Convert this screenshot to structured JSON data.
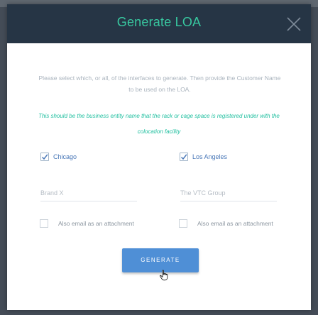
{
  "modal": {
    "title": "Generate LOA",
    "close_icon": "close-icon",
    "intro_text": "Please select which, or all, of the interfaces to generate. Then provide the Customer Name to be used on the LOA.",
    "note_text": "This should be the business entity name that the rack or cage space is registered under with the colocation facility"
  },
  "locations": [
    {
      "label": "Chicago",
      "checked": true,
      "name_placeholder": "Brand X",
      "email_label": "Also email as an attachment",
      "email_checked": false
    },
    {
      "label": "Los Angeles",
      "checked": true,
      "name_placeholder": "The VTC Group",
      "email_label": "Also email as an attachment",
      "email_checked": false
    }
  ],
  "generate_label": "GENERATE",
  "colors": {
    "header_bg": "#263545",
    "title": "#38c8a0",
    "note": "#1fbf9f",
    "button": "#4f8fd6",
    "check": "#4a78b8"
  }
}
